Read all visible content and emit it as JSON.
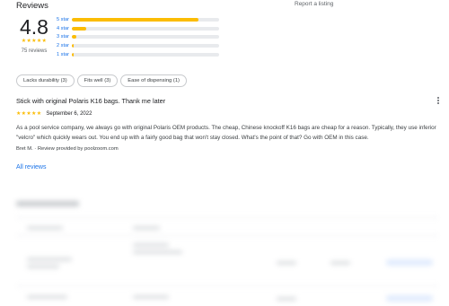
{
  "header": {
    "title": "Reviews",
    "report_link": "Report a listing"
  },
  "summary": {
    "average": "4.8",
    "stars": "★★★★★",
    "count_text": "75 reviews"
  },
  "histogram": [
    {
      "label": "5 star",
      "fraction": 0.86
    },
    {
      "label": "4 star",
      "fraction": 0.1
    },
    {
      "label": "3 star",
      "fraction": 0.03
    },
    {
      "label": "2 star",
      "fraction": 0.01
    },
    {
      "label": "1 star",
      "fraction": 0.005
    }
  ],
  "chips": [
    "Lacks durability (3)",
    "Fits well (3)",
    "Ease of dispensing (1)"
  ],
  "review": {
    "title": "Stick with original Polaris K16 bags. Thank me later",
    "stars": "★★★★★",
    "date": "September 6, 2022",
    "body": "As a pool service company, we always go with original Polaris OEM products. The cheap, Chinese knockoff K16 bags are cheap for a reason. Typically, they use inferior \"velcro\" which quickly wears out. You end up with a fairly good bag that won't stay closed. What's the point of that? Go with OEM in this case.",
    "author": "Bret M. · Review provided by poolzoom.com"
  },
  "all_reviews_label": "All reviews",
  "colors": {
    "star": "#fbbc04",
    "link": "#1a73e8",
    "track": "#e8eaed"
  }
}
